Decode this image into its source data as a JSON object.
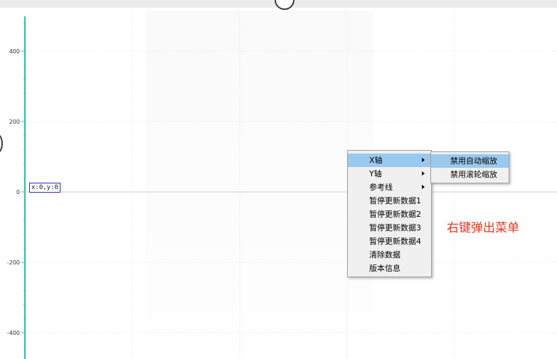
{
  "theme": {
    "axis_color": "#2fbf9f",
    "annotation_color": "#e8341c",
    "menu_highlight": "#99c9ef",
    "coord_border": "#2a2ad0"
  },
  "chart_data": {
    "type": "line",
    "ylim": [
      -460,
      500
    ],
    "y_ticks": [
      "400",
      "200",
      "0",
      "-200",
      "-400"
    ],
    "series": [
      {
        "values": [
          0,
          0
        ]
      }
    ],
    "grid": true
  },
  "coord_readout": "x:0,y:0",
  "context_menu": {
    "items": [
      {
        "label": "X轴",
        "submenu": true,
        "active": true
      },
      {
        "label": "Y轴",
        "submenu": true,
        "active": false
      },
      {
        "label": "参考线",
        "submenu": true,
        "active": false
      },
      {
        "label": "暂停更新数据1",
        "submenu": false,
        "active": false
      },
      {
        "label": "暂停更新数据2",
        "submenu": false,
        "active": false
      },
      {
        "label": "暂停更新数据3",
        "submenu": false,
        "active": false
      },
      {
        "label": "暂停更新数据4",
        "submenu": false,
        "active": false
      },
      {
        "label": "清除数据",
        "submenu": false,
        "active": false
      },
      {
        "label": "版本信息",
        "submenu": false,
        "active": false
      }
    ],
    "x_axis_submenu": {
      "items": [
        {
          "label": "禁用自动缩放",
          "active": true
        },
        {
          "label": "禁用滚轮缩放",
          "active": false
        }
      ]
    }
  },
  "annotation": "右键弹出菜单"
}
